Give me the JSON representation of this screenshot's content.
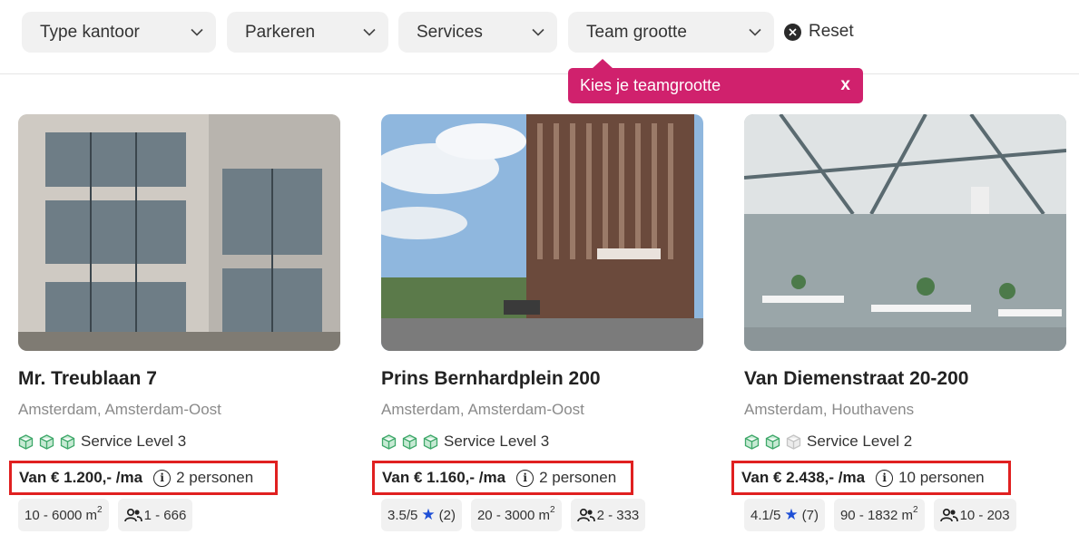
{
  "filters": [
    {
      "label": "Type kantoor"
    },
    {
      "label": "Parkeren"
    },
    {
      "label": "Services"
    },
    {
      "label": "Team grootte"
    }
  ],
  "reset_label": "Reset",
  "tooltip": {
    "text": "Kies je teamgrootte",
    "close": "x"
  },
  "listings": [
    {
      "title": "Mr. Treublaan 7",
      "city": "Amsterdam",
      "area": "Amsterdam-Oost",
      "service_level": "Service Level 3",
      "service_level_value": 3,
      "price": "Van € 1.200,- /ma",
      "persons": "2 personen",
      "size": "10 - 6000 m",
      "size_unit_exp": "2",
      "team_range": "1 - 666"
    },
    {
      "title": "Prins Bernhardplein 200",
      "city": "Amsterdam",
      "area": "Amsterdam-Oost",
      "service_level": "Service Level 3",
      "service_level_value": 3,
      "price": "Van € 1.160,- /ma",
      "persons": "2 personen",
      "rating": "3.5/5",
      "reviews": "(2)",
      "size": "20 - 3000 m",
      "size_unit_exp": "2",
      "team_range": "2 - 333"
    },
    {
      "title": "Van Diemenstraat 20-200",
      "city": "Amsterdam",
      "area": "Houthavens",
      "service_level": "Service Level 2",
      "service_level_value": 2,
      "price": "Van € 2.438,- /ma",
      "persons": "10 personen",
      "rating": "4.1/5",
      "reviews": "(7)",
      "size": "90 - 1832 m",
      "size_unit_exp": "2",
      "team_range": "10 - 203"
    }
  ],
  "colors": {
    "accent_pink": "#d0216d",
    "highlight_red": "#e02020",
    "service_green": "#3fa86a",
    "star_blue": "#1e4fd6"
  }
}
